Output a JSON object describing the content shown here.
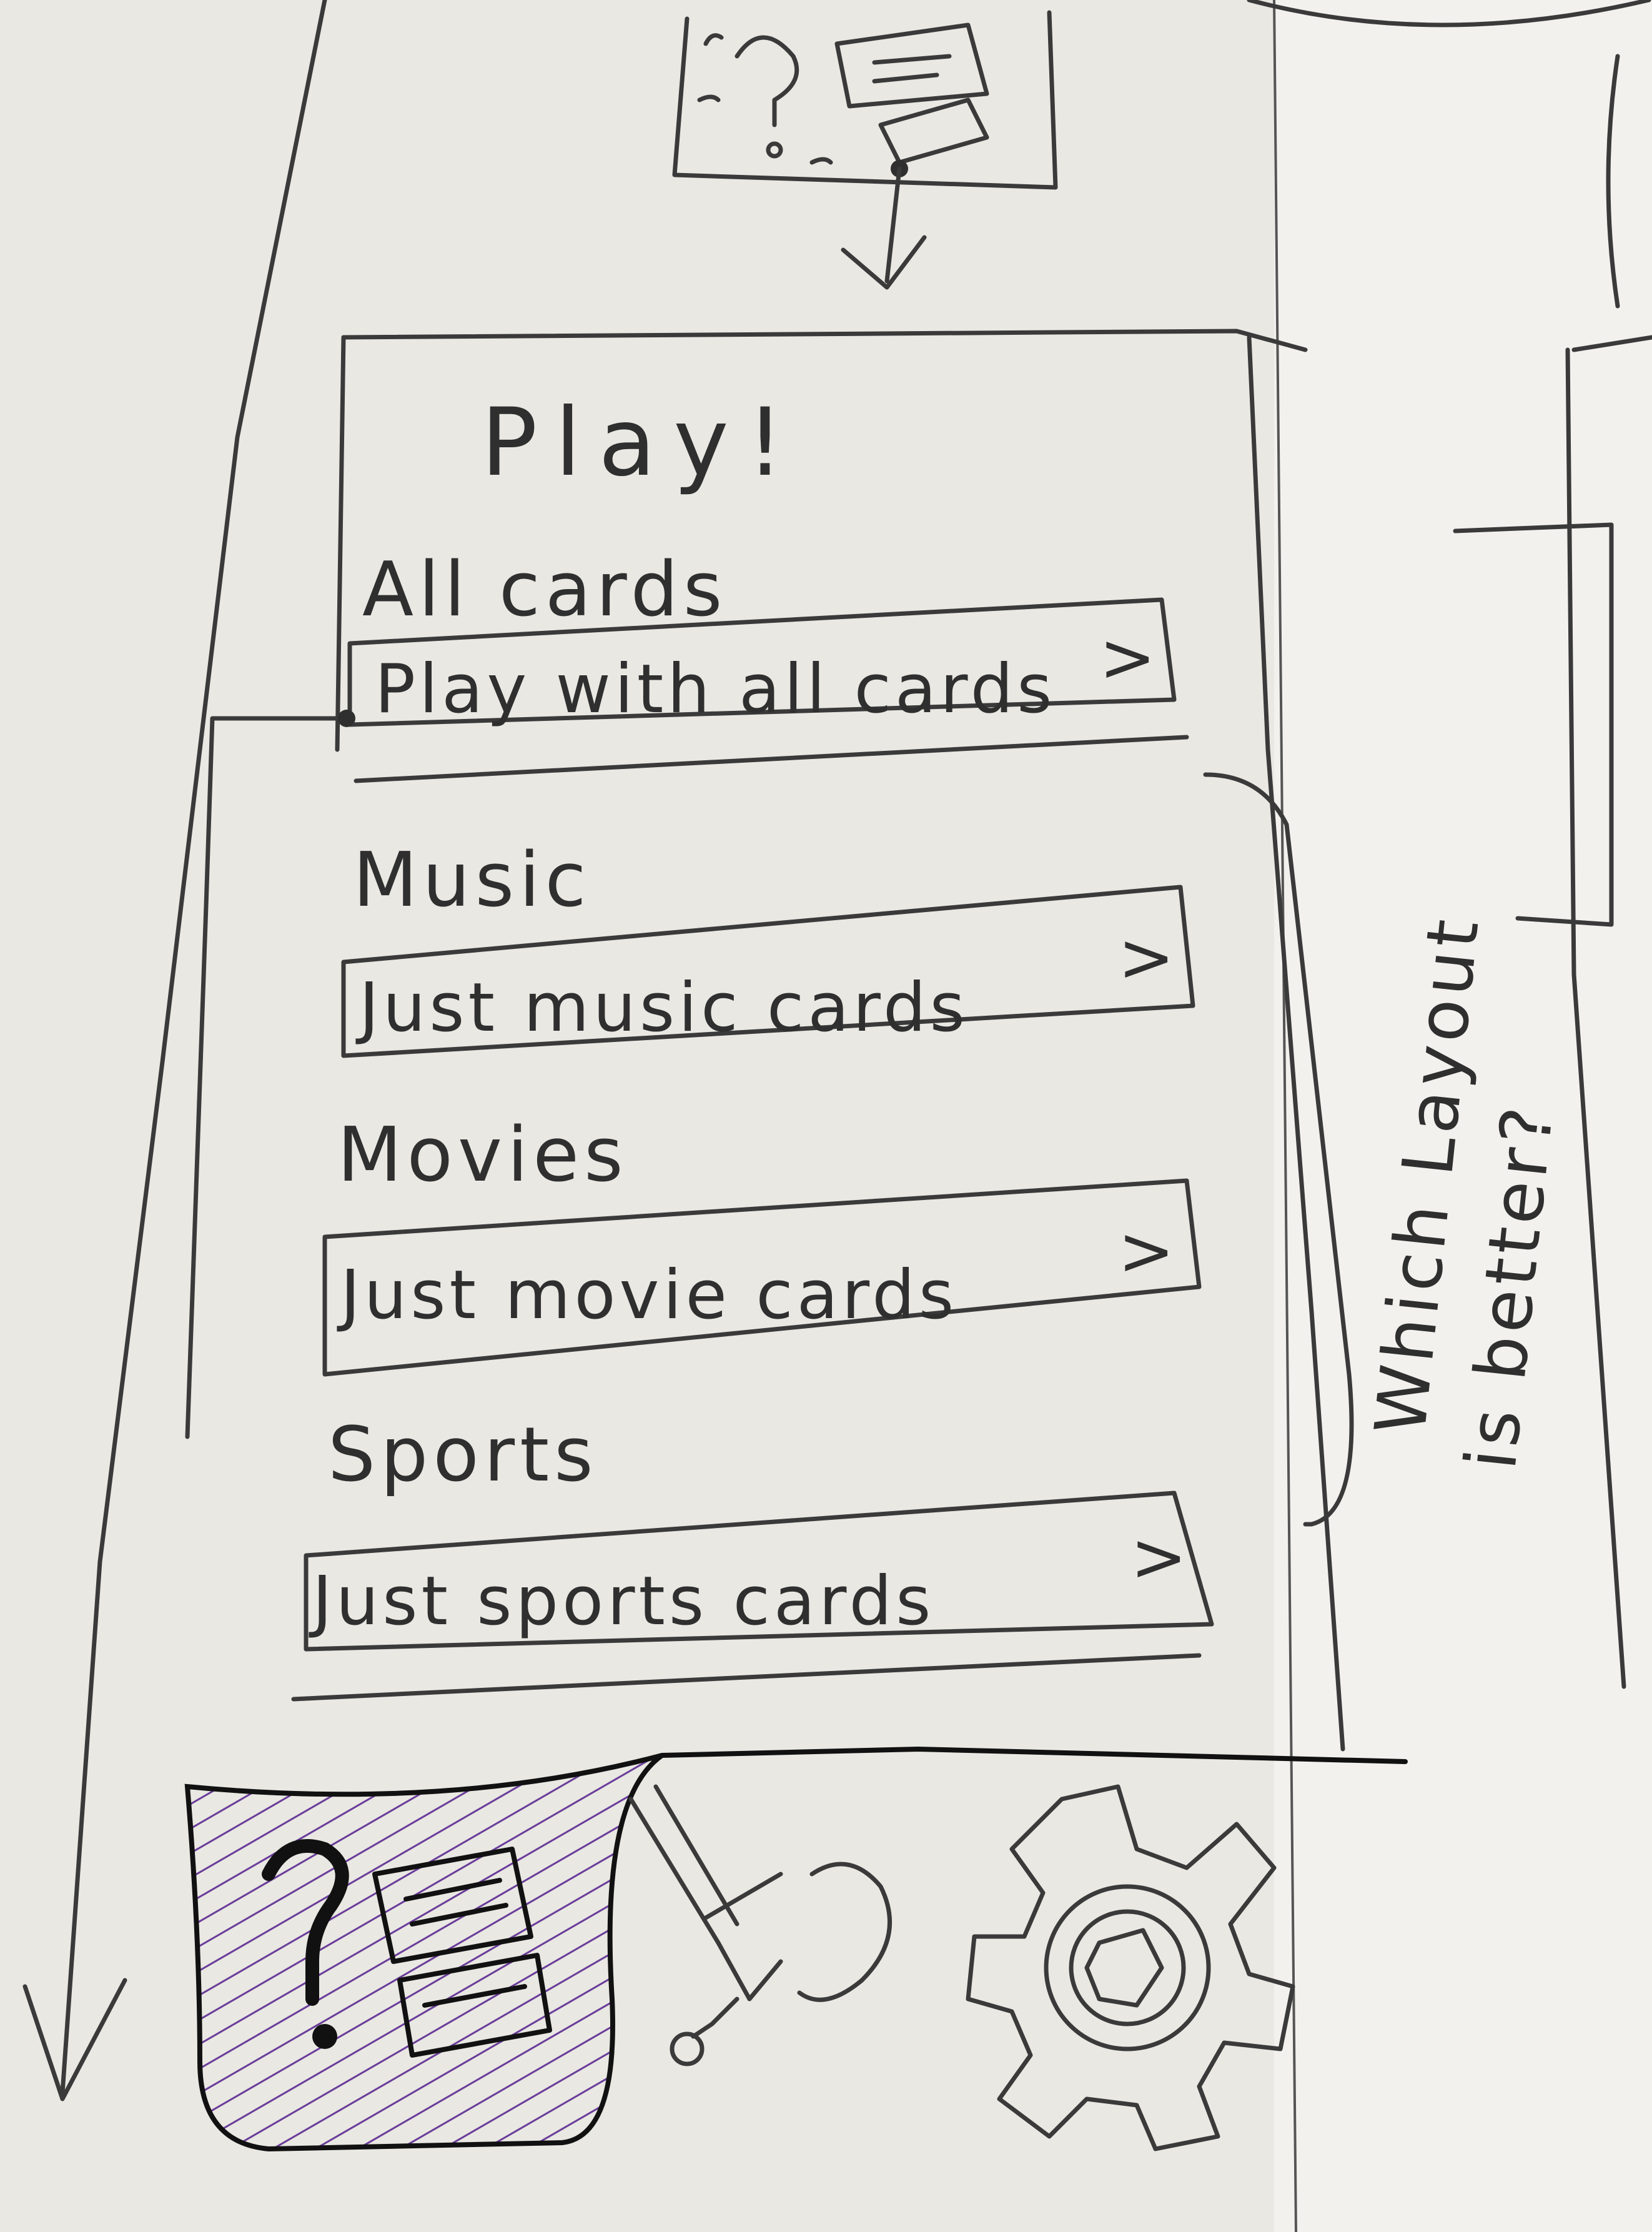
{
  "screen": {
    "title": "Play!",
    "sections": [
      {
        "heading": "All cards",
        "row_label": "Play with all cards",
        "chevron": ">"
      },
      {
        "heading": "Music",
        "row_label": "Just music cards",
        "chevron": ">"
      },
      {
        "heading": "Movies",
        "row_label": "Just movie cards",
        "chevron": ">"
      },
      {
        "heading": "Sports",
        "row_label": "Just sports cards",
        "chevron": ">"
      }
    ]
  },
  "side_note": {
    "line1": "Which Layout",
    "line2": "is better?"
  },
  "tab_bar": {
    "items": [
      {
        "icon": "question-cards-icon",
        "active": true
      },
      {
        "icon": "pen-stamp-icon",
        "active": false
      },
      {
        "icon": "gear-icon",
        "active": false
      }
    ]
  },
  "colors": {
    "paper": "#e9e8e3",
    "pencil": "#3a3a3a",
    "active_highlight": "#6a3d9a"
  }
}
